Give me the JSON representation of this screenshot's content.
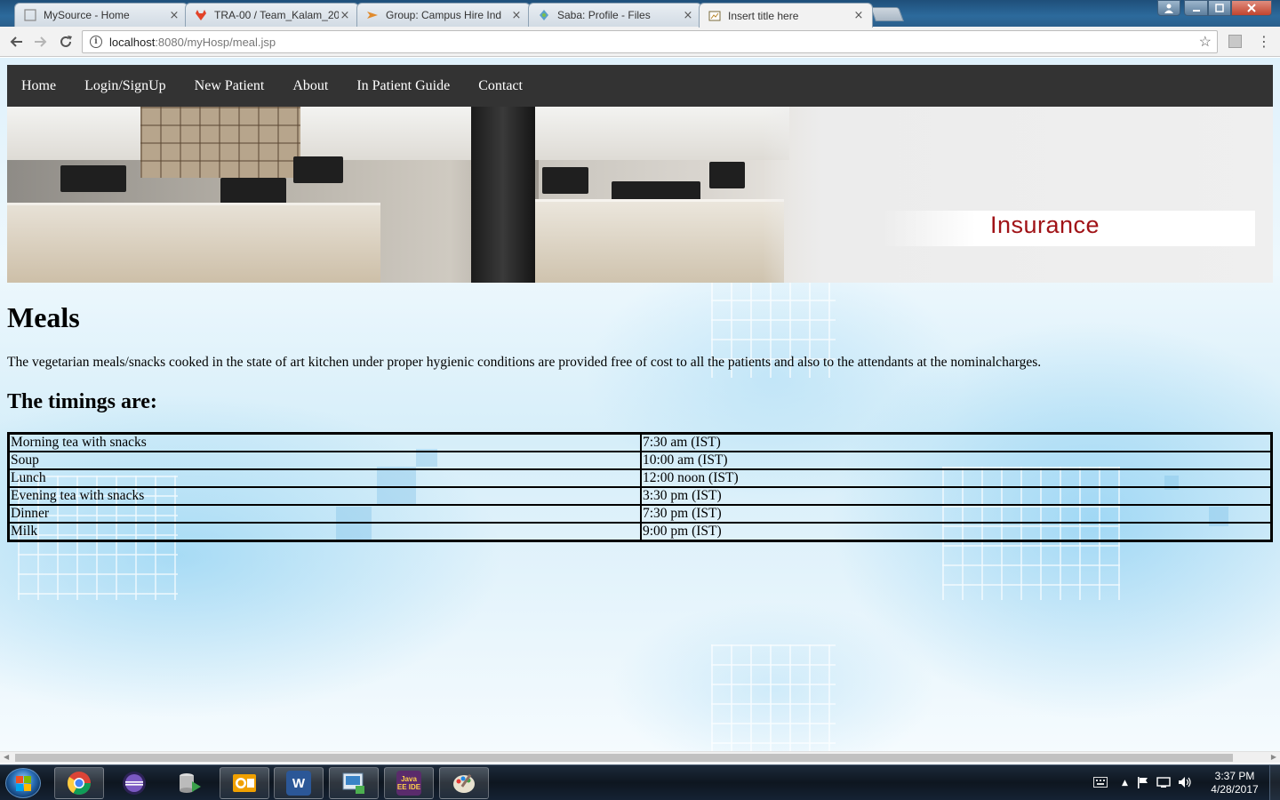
{
  "browser": {
    "tabs": [
      {
        "title": "MySource - Home",
        "icon": "mysource-favicon"
      },
      {
        "title": "TRA-00 / Team_Kalam_20",
        "icon": "gitlab-favicon"
      },
      {
        "title": "Group: Campus Hire Ind",
        "icon": "campus-favicon"
      },
      {
        "title": "Saba: Profile - Files",
        "icon": "saba-favicon"
      },
      {
        "title": "Insert title here",
        "icon": "page-favicon",
        "active": true
      }
    ],
    "close_glyph": "×",
    "url_host": "localhost",
    "url_rest": ":8080/myHosp/meal.jsp"
  },
  "nav": {
    "items": [
      "Home",
      "Login/SignUp",
      "New Patient",
      "About",
      "In Patient Guide",
      "Contact"
    ]
  },
  "banner": {
    "label": "Insurance"
  },
  "main": {
    "heading": "Meals",
    "description": "The vegetarian meals/snacks cooked in the state of art kitchen under proper hygienic conditions are provided free of cost to all the patients and also to the attendants at the nominalcharges.",
    "subheading": "The timings are:",
    "table": [
      {
        "meal": "Morning tea with snacks",
        "time": "7:30 am (IST)"
      },
      {
        "meal": "Soup",
        "time": "10:00 am (IST)"
      },
      {
        "meal": "Lunch",
        "time": "12:00 noon (IST)"
      },
      {
        "meal": "Evening tea with snacks",
        "time": "3:30 pm (IST)"
      },
      {
        "meal": "Dinner",
        "time": "7:30 pm (IST)"
      },
      {
        "meal": "Milk",
        "time": "9:00 pm (IST)"
      }
    ]
  },
  "taskbar": {
    "apps": [
      {
        "name": "chrome",
        "icon": "chrome-icon"
      },
      {
        "name": "eclipse",
        "icon": "eclipse-icon"
      },
      {
        "name": "database",
        "icon": "database-icon"
      },
      {
        "name": "outlook",
        "icon": "outlook-icon"
      },
      {
        "name": "word",
        "icon": "word-icon",
        "letter": "W"
      },
      {
        "name": "remote",
        "icon": "remote-desktop-icon"
      },
      {
        "name": "java-ee-ide",
        "icon": "java-ee-ide-icon",
        "letter": "Java EE IDE"
      },
      {
        "name": "paint",
        "icon": "paint-icon"
      }
    ],
    "time": "3:37 PM",
    "date": "4/28/2017"
  },
  "colors": {
    "nav_bg": "#333333",
    "insurance_red": "#a01216"
  }
}
